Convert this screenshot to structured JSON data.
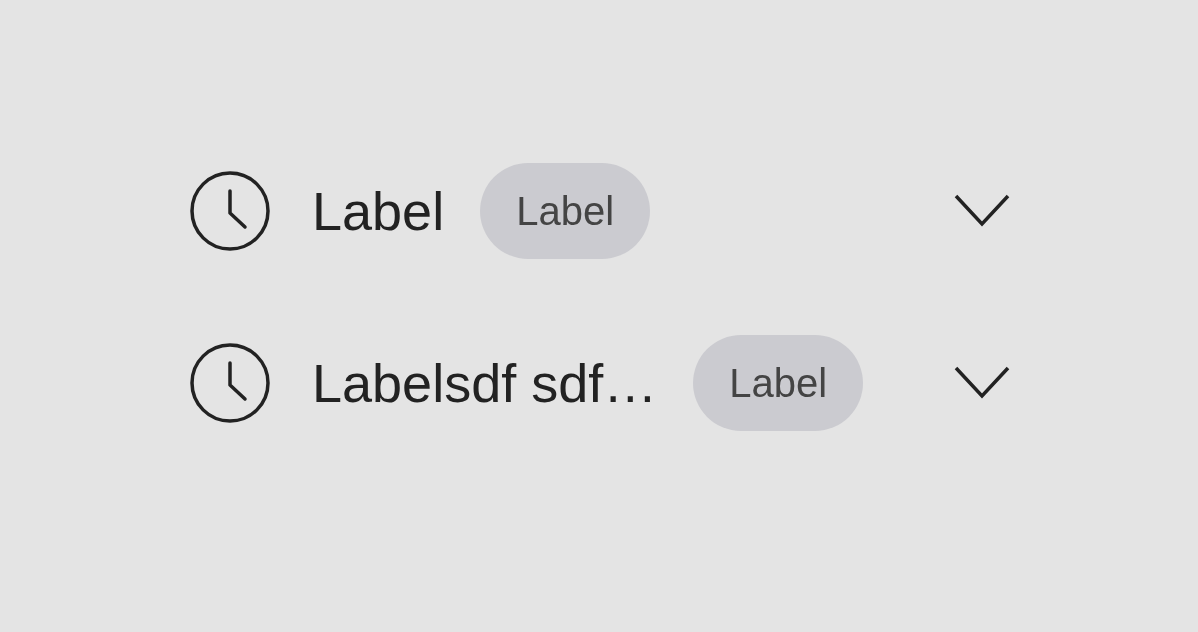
{
  "rows": [
    {
      "label": "Label",
      "badge": "Label"
    },
    {
      "label": "Labelsdf sdf…",
      "badge": "Label"
    }
  ]
}
